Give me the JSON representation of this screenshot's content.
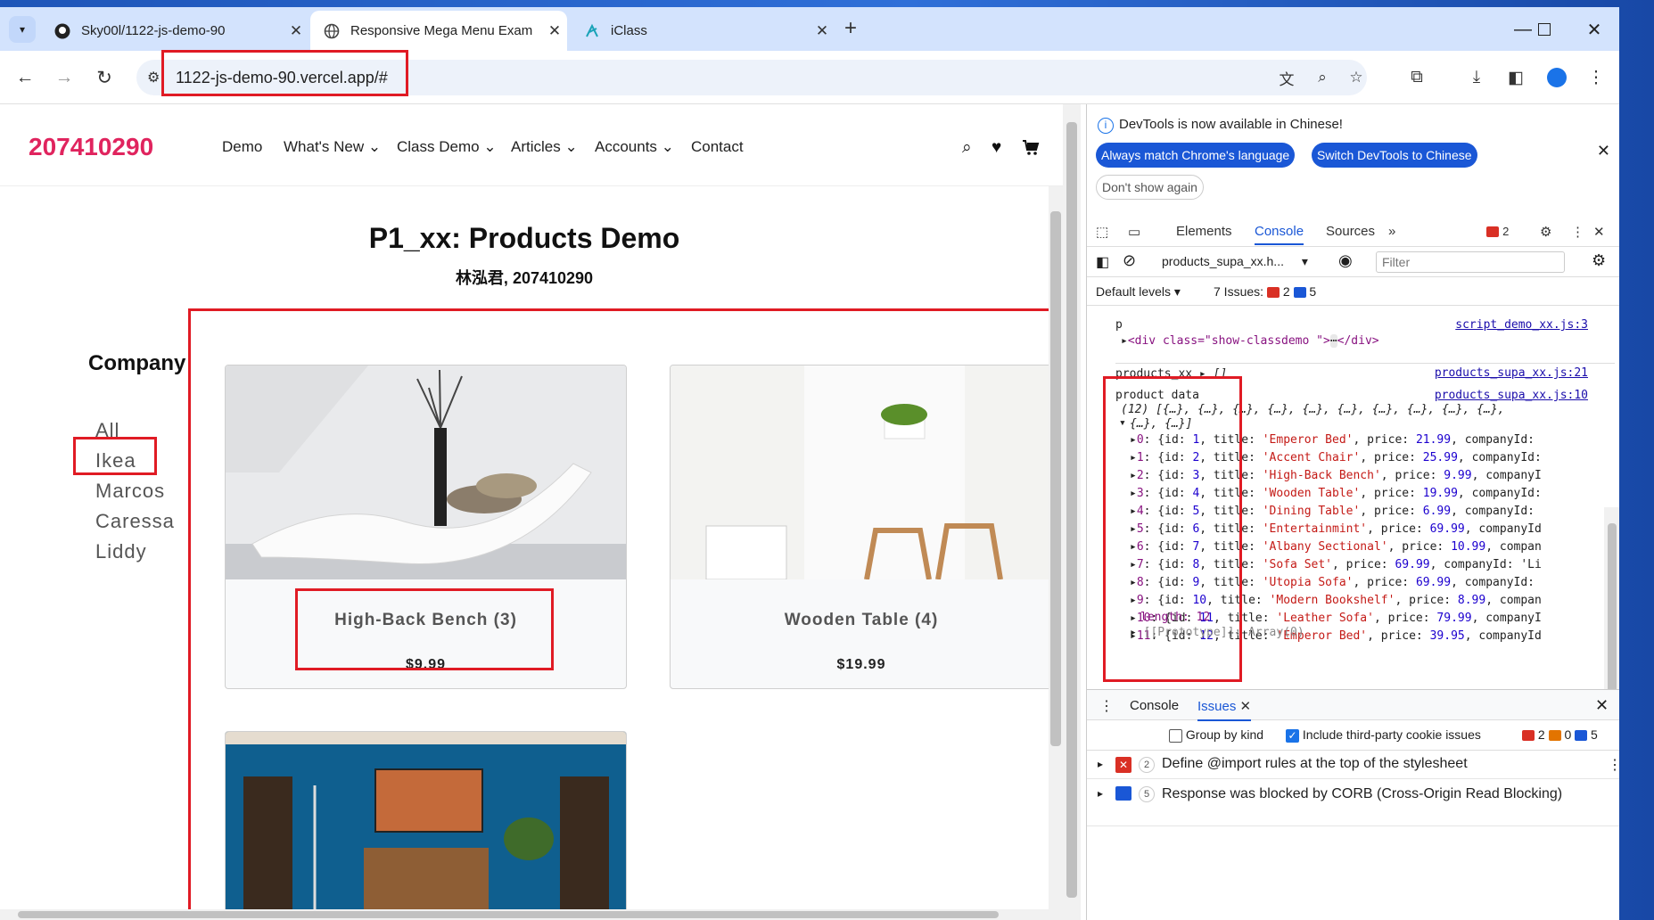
{
  "browser": {
    "tabs": [
      {
        "title": "Sky00l/1122-js-demo-90"
      },
      {
        "title": "Responsive Mega Menu Exam"
      },
      {
        "title": "iClass"
      }
    ],
    "url": "1122-js-demo-90.vercel.app/#"
  },
  "site": {
    "brand": "207410290",
    "menu": [
      "Demo",
      "What's New",
      "Class Demo",
      "Articles",
      "Accounts",
      "Contact"
    ],
    "title": "P1_xx: Products Demo",
    "subtitle": "林泓君, 207410290",
    "company_heading": "Company",
    "companies": [
      "All",
      "Ikea",
      "Marcos",
      "Caressa",
      "Liddy"
    ],
    "products": [
      {
        "title": "High-Back Bench (3)",
        "price": "$9.99"
      },
      {
        "title": "Wooden Table (4)",
        "price": "$19.99"
      }
    ]
  },
  "devtools": {
    "info": "DevTools is now available in Chinese!",
    "btn_match": "Always match Chrome's language",
    "btn_switch": "Switch DevTools to Chinese",
    "btn_dont": "Don't show again",
    "tabs": [
      "Elements",
      "Console",
      "Sources"
    ],
    "error_count": "2",
    "context": "products_supa_xx.h...",
    "filter_placeholder": "Filter",
    "levels": "Default levels",
    "issues_label": "7 Issues:",
    "issues_err": "2",
    "issues_info": "5",
    "console": {
      "p_label": "p",
      "p_src": "script_demo_xx.js:3",
      "div_line": "<div class=\"show-classdemo \">",
      "div_ellipsis": "⋯",
      "div_close": "</div>",
      "products_label": "products_xx",
      "products_val": "[]",
      "products_src": "products_supa_xx.js:21",
      "data_label": "product data",
      "data_src": "products_supa_xx.js:10",
      "array_summary_1": "(12) [{…}, {…}, {…}, {…}, {…}, {…}, {…}, {…}, {…}, {…},",
      "array_summary_2": "{…}, {…}]",
      "rows": [
        {
          "idx": "0",
          "id": "1",
          "title": "'Emperor Bed'",
          "price": "21.99",
          "tail": "companyId:"
        },
        {
          "idx": "1",
          "id": "2",
          "title": "'Accent Chair'",
          "price": "25.99",
          "tail": "companyId:"
        },
        {
          "idx": "2",
          "id": "3",
          "title": "'High-Back Bench'",
          "price": "9.99",
          "tail": "companyI"
        },
        {
          "idx": "3",
          "id": "4",
          "title": "'Wooden Table'",
          "price": "19.99",
          "tail": "companyId:"
        },
        {
          "idx": "4",
          "id": "5",
          "title": "'Dining Table'",
          "price": "6.99",
          "tail": "companyId:"
        },
        {
          "idx": "5",
          "id": "6",
          "title": "'Entertainmint'",
          "price": "69.99",
          "tail": "companyId"
        },
        {
          "idx": "6",
          "id": "7",
          "title": "'Albany Sectional'",
          "price": "10.99",
          "tail": "compan"
        },
        {
          "idx": "7",
          "id": "8",
          "title": "'Sofa Set'",
          "price": "69.99",
          "tail": "companyId: 'Li"
        },
        {
          "idx": "8",
          "id": "9",
          "title": "'Utopia Sofa'",
          "price": "69.99",
          "tail": "companyId:"
        },
        {
          "idx": "9",
          "id": "10",
          "title": "'Modern Bookshelf'",
          "price": "8.99",
          "tail": "compan"
        },
        {
          "idx": "10",
          "id": "11",
          "title": "'Leather Sofa'",
          "price": "79.99",
          "tail": "companyI"
        },
        {
          "idx": "11",
          "id": "12",
          "title": "'Emperor Bed'",
          "price": "39.95",
          "tail": "companyId"
        }
      ],
      "length_line": "length: 12",
      "proto_line": "[[Prototype]]: Array(0)"
    },
    "drawer": {
      "tab_console": "Console",
      "tab_issues": "Issues",
      "group_by_kind": "Group by kind",
      "include_third_party": "Include third-party cookie issues",
      "count_err": "2",
      "count_warn": "0",
      "count_info": "5",
      "issues": [
        {
          "count": "2",
          "text": "Define @import rules at the top of the stylesheet"
        },
        {
          "count": "5",
          "text": "Response was blocked by CORB (Cross-Origin Read Blocking)"
        }
      ]
    }
  }
}
